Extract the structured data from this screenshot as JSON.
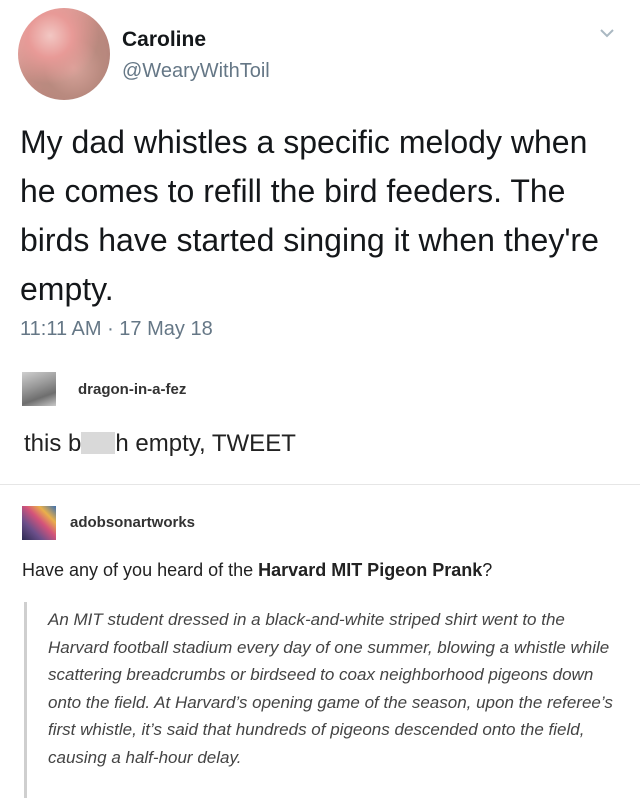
{
  "tweet": {
    "display_name": "Caroline",
    "handle": "@WearyWithToil",
    "text": "My dad whistles a specific melody when he comes to refill the bird feeders. The birds have started singing it when they're empty.",
    "timestamp": "11:11 AM · 17 May 18"
  },
  "posts": [
    {
      "username": "dragon-in-a-fez",
      "text_before": "this b",
      "text_after": "h empty, TWEET"
    },
    {
      "username": "adobsonartworks",
      "question_prefix": "Have any of you heard of the ",
      "question_bold": "Harvard MIT Pigeon Prank",
      "question_suffix": "?",
      "quote": "An MIT student dressed in a black-and-white striped shirt went to the Harvard football stadium every day of one summer, blowing a whistle while scattering breadcrumbs or birdseed to coax neighborhood pigeons down onto the field. At Harvard’s opening game of the season, upon the referee’s first whistle, it’s said that hundreds of pigeons descended onto the field, causing a half-hour delay."
    }
  ],
  "icons": {
    "menu": "chevron-down-icon"
  },
  "colors": {
    "primary_text": "#14171a",
    "secondary_text": "#657786",
    "quote_bar": "#cfcfcf"
  }
}
